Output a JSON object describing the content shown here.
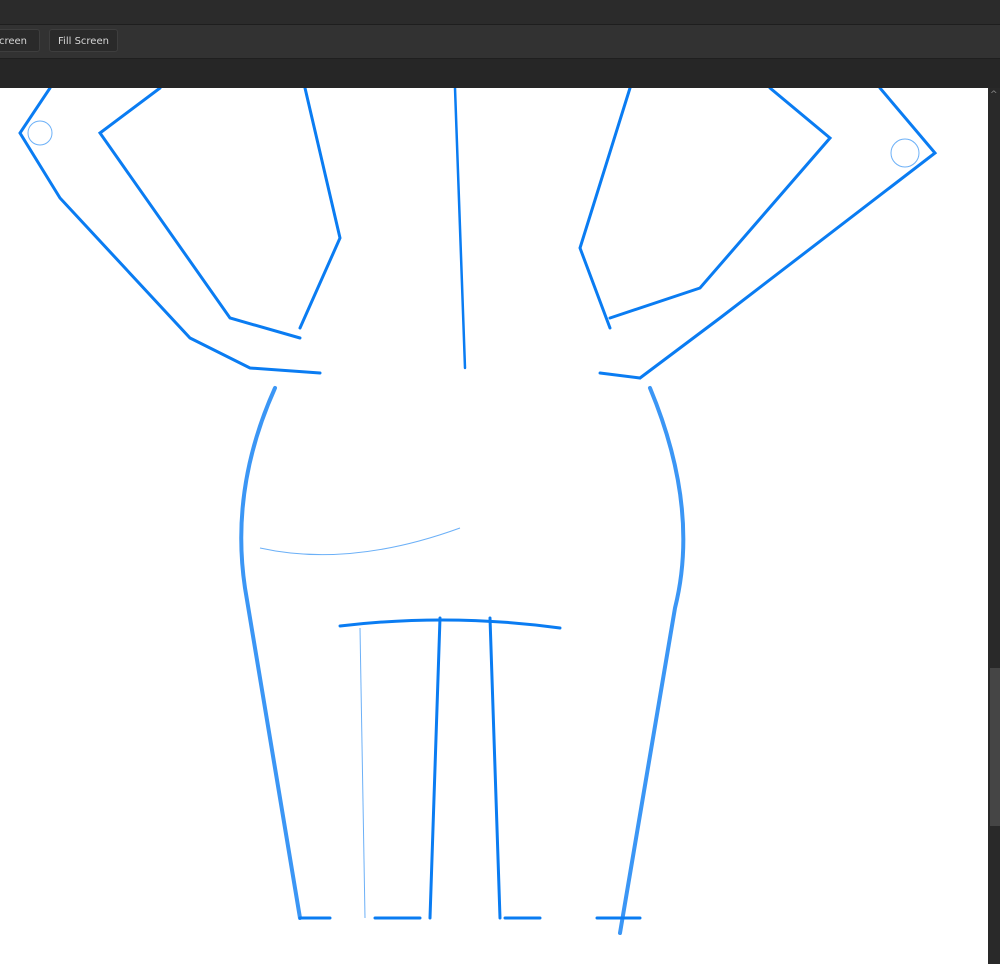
{
  "toolbar": {
    "fit_screen_label": "Fit Screen",
    "fill_screen_label": "Fill Screen"
  },
  "canvas": {
    "stroke_color": "#0a7cf2",
    "background": "#ffffff"
  },
  "scrollbar": {
    "up_icon": "chevron-up-icon"
  }
}
